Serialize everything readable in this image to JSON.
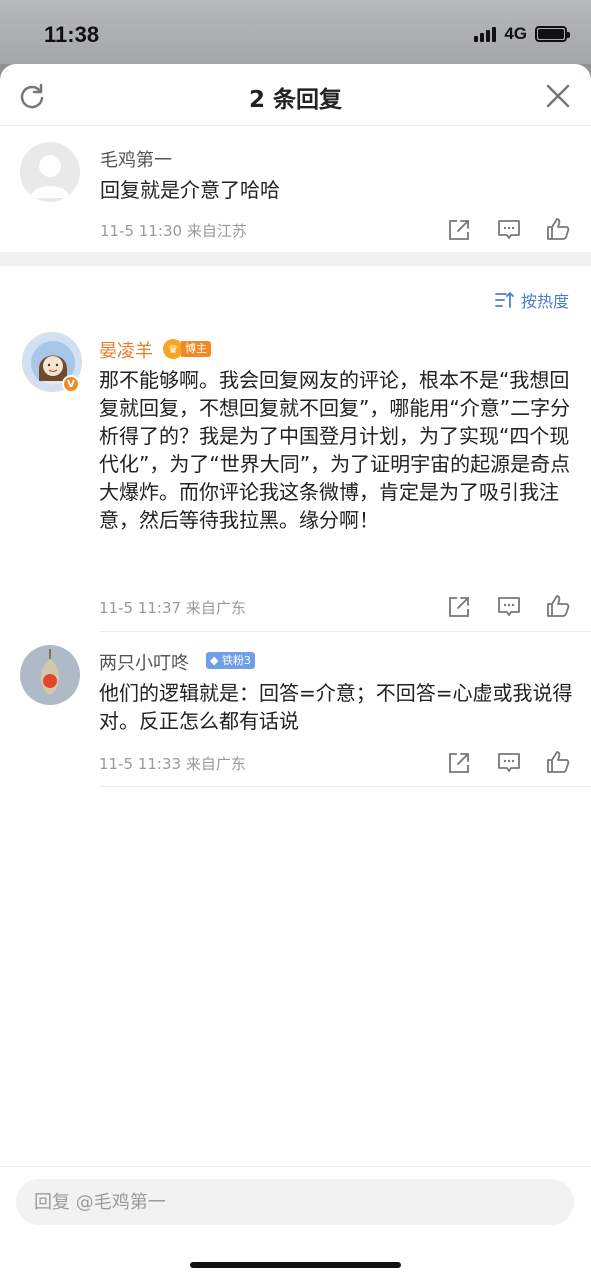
{
  "status_bar": {
    "time": "11:38",
    "network": "4G"
  },
  "sheet": {
    "title": "2 条回复"
  },
  "root_comment": {
    "username": "毛鸡第一",
    "text": "回复就是介意了哈哈",
    "time": "11-5 11:30",
    "location": "来自江苏"
  },
  "sort": {
    "label": "按热度"
  },
  "replies": [
    {
      "username": "晏凌羊",
      "badge": "博主",
      "verified": "V",
      "text": "那不能够啊。我会回复网友的评论，根本不是“我想回复就回复，不想回复就不回复”，哪能用“介意”二字分析得了的？我是为了中国登月计划，为了实现“四个现代化”，为了“世界大同”，为了证明宇宙的起源是奇点大爆炸。而你评论我这条微博，肯定是为了吸引我注意，然后等待我拉黑。缘分啊！",
      "time": "11-5 11:37",
      "location": "来自广东"
    },
    {
      "username": "两只小叮咚",
      "badge": "铁粉3",
      "text": "他们的逻辑就是：回答=介意；不回答=心虚或我说得对。反正怎么都有话说",
      "time": "11-5 11:33",
      "location": "来自广东"
    }
  ],
  "reply_input": {
    "placeholder": "回复 @毛鸡第一"
  },
  "colors": {
    "accent_orange": "#ef7a2a",
    "link_blue": "#4a7fc9",
    "fan_badge": "#6f9fe6"
  }
}
